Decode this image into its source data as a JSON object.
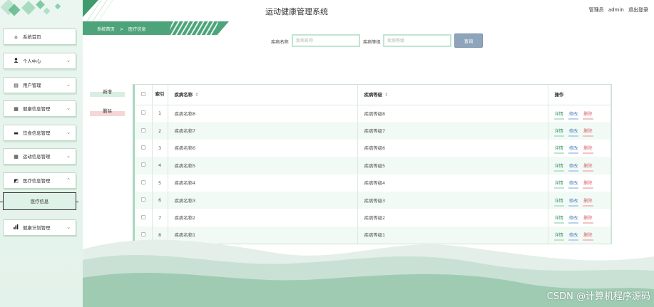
{
  "header": {
    "title": "运动健康管理系统",
    "user_role": "管理员",
    "username": "admin",
    "logout": "退出登录"
  },
  "breadcrumb": {
    "home": "系统首页",
    "separator": ">",
    "current": "医疗信息"
  },
  "sidebar": {
    "items": [
      {
        "label": "系统首页",
        "icon": "home-icon",
        "glyph": "⌂"
      },
      {
        "label": "个人中心",
        "icon": "person-icon",
        "glyph": "👤"
      },
      {
        "label": "用户管理",
        "icon": "document-icon",
        "glyph": "▤"
      },
      {
        "label": "健康信息管理",
        "icon": "grid-icon",
        "glyph": "▦"
      },
      {
        "label": "饮食信息管理",
        "icon": "briefcase-icon",
        "glyph": "▬"
      },
      {
        "label": "运动信息管理",
        "icon": "grid-icon",
        "glyph": "▦"
      },
      {
        "label": "医疗信息管理",
        "icon": "chart-box-icon",
        "glyph": "◩"
      },
      {
        "label": "健康计划管理",
        "icon": "bar-chart-icon",
        "glyph": "▮"
      }
    ],
    "sub_item": "医疗信息"
  },
  "search": {
    "name_label": "疾病名称",
    "name_placeholder": "疾病名称",
    "level_label": "疾病等级",
    "level_placeholder": "疾病等级",
    "button": "查询"
  },
  "actions": {
    "add": "新增",
    "delete": "删除"
  },
  "table": {
    "headers": {
      "index": "索引",
      "name": "疾病名称",
      "level": "疾病等级",
      "ops": "操作"
    },
    "sort_glyph": "⇕",
    "rows": [
      {
        "index": "1",
        "name": "疾病名称8",
        "level": "疾病等级8"
      },
      {
        "index": "2",
        "name": "疾病名称7",
        "level": "疾病等级7"
      },
      {
        "index": "3",
        "name": "疾病名称6",
        "level": "疾病等级6"
      },
      {
        "index": "4",
        "name": "疾病名称5",
        "level": "疾病等级5"
      },
      {
        "index": "5",
        "name": "疾病名称4",
        "level": "疾病等级4"
      },
      {
        "index": "6",
        "name": "疾病名称3",
        "level": "疾病等级3"
      },
      {
        "index": "7",
        "name": "疾病名称2",
        "level": "疾病等级2"
      },
      {
        "index": "8",
        "name": "疾病名称1",
        "level": "疾病等级1"
      }
    ],
    "ops": {
      "detail": "详情",
      "edit": "修改",
      "delete": "删除"
    }
  },
  "watermark": "CSDN @计算机程序源码",
  "colors": {
    "accent": "#4da47b",
    "query_button": "#8da4bb",
    "edit": "#4a7fc1",
    "danger": "#d9646d"
  }
}
